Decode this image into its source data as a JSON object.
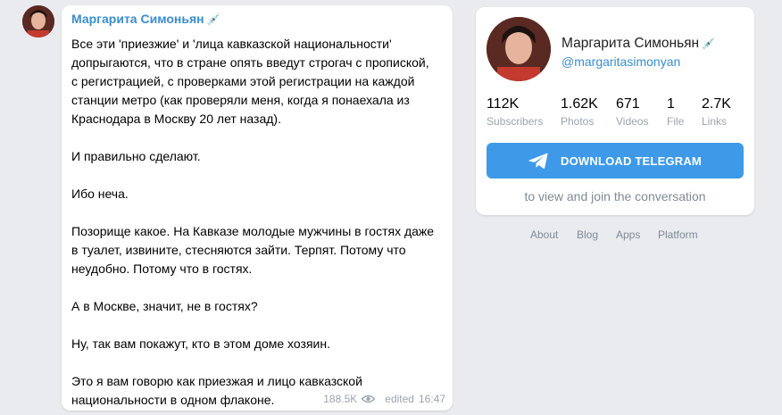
{
  "message": {
    "author": "Маргарита Симоньян",
    "author_emoji": "💉",
    "text": "Все эти 'приезжие' и 'лица кавказской национальности'\nдопрыгаются, что в стране опять введут строгач с пропиской,\nс регистрацией, с проверками этой регистрации на каждой\nстанции метро (как проверяли меня, когда я понаехала из\nКраснодара в Москву 20 лет назад).\n\nИ правильно сделают.\n\nИбо неча.\n\nПозорище какое. На Кавказе молодые мужчины в гостях даже\nв туалет, извините, стесняются зайти. Терпят. Потому что\nнеудобно. Потому что в гостях.\n\nА в Москве, значит, не в гостях?\n\nНу, так вам покажут, кто в этом доме хозяин.\n\nЭто я вам говорю как приезжая и лицо кавказской\nнациональности в одном флаконе.",
    "views": "188.5K",
    "edited_label": "edited",
    "time": "16:47"
  },
  "channel": {
    "name": "Маргарита Симоньян",
    "name_emoji": "💉",
    "username": "@margaritasimonyan",
    "stats": [
      {
        "value": "112K",
        "label": "Subscribers"
      },
      {
        "value": "1.62K",
        "label": "Photos"
      },
      {
        "value": "671",
        "label": "Videos"
      },
      {
        "value": "1",
        "label": "File"
      },
      {
        "value": "2.7K",
        "label": "Links"
      }
    ],
    "download_button": "DOWNLOAD TELEGRAM",
    "note": "to view and join the conversation"
  },
  "footer_links": [
    "About",
    "Blog",
    "Apps",
    "Platform"
  ],
  "colors": {
    "accent": "#3a8dd0",
    "button": "#3e9ae8",
    "background": "#e9ebee"
  }
}
